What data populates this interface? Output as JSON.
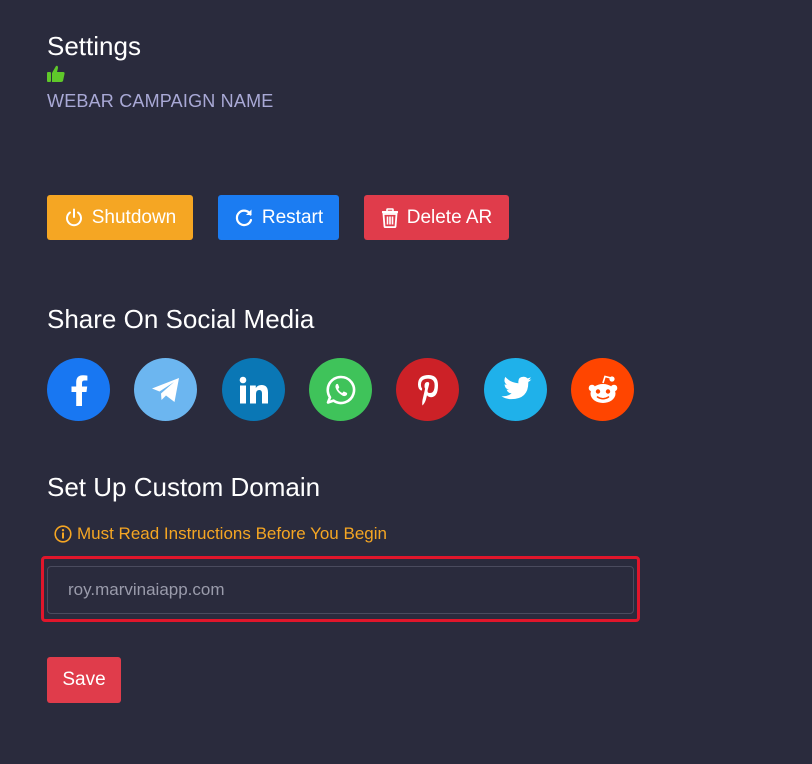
{
  "header": {
    "title": "Settings",
    "campaign_name": "WEBAR CAMPAIGN NAME"
  },
  "actions": {
    "shutdown_label": "Shutdown",
    "restart_label": "Restart",
    "delete_label": "Delete AR"
  },
  "social": {
    "heading": "Share On Social Media",
    "items": [
      {
        "name": "facebook",
        "icon": "facebook-icon",
        "color": "#1877f2"
      },
      {
        "name": "telegram",
        "icon": "telegram-icon",
        "color": "#6cb6f0"
      },
      {
        "name": "linkedin",
        "icon": "linkedin-icon",
        "color": "#0a77b5"
      },
      {
        "name": "whatsapp",
        "icon": "whatsapp-icon",
        "color": "#3fc35a"
      },
      {
        "name": "pinterest",
        "icon": "pinterest-icon",
        "color": "#cc2127"
      },
      {
        "name": "twitter",
        "icon": "twitter-icon",
        "color": "#1fb1ea"
      },
      {
        "name": "reddit",
        "icon": "reddit-icon",
        "color": "#ff4500"
      }
    ]
  },
  "domain": {
    "heading": "Set Up Custom Domain",
    "instructions": "Must Read Instructions Before You Begin",
    "placeholder": "roy.marvinaiapp.com",
    "value": ""
  },
  "save_label": "Save",
  "colors": {
    "background": "#2a2b3d",
    "shutdown": "#f5a623",
    "restart": "#1b7cf2",
    "delete": "#e03c4b",
    "warning_text": "#f5a623",
    "highlight_border": "#e0162b",
    "thumb": "#5fc82a"
  }
}
